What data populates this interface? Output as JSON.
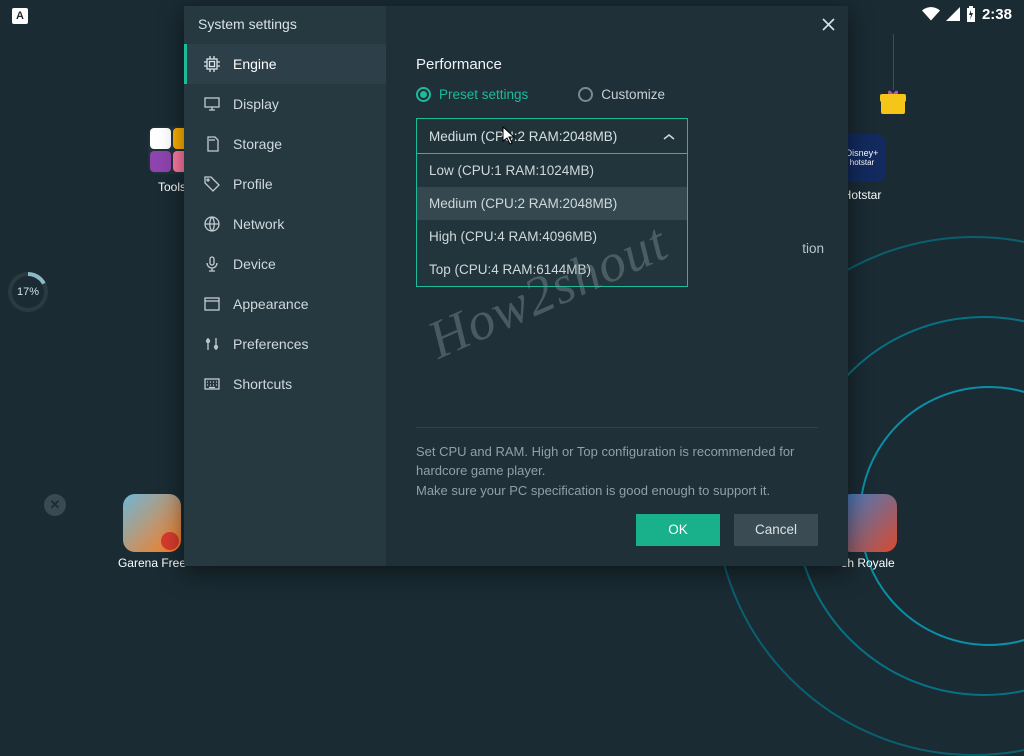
{
  "status_bar": {
    "time": "2:38"
  },
  "progress_badge": "17%",
  "desktop": {
    "tools_label": "Tools",
    "hotstar_label": "Hotstar",
    "garena_label": "Garena Free",
    "royale_label": "sh Royale"
  },
  "watermark": "How2shout",
  "modal": {
    "title": "System settings",
    "nav": [
      {
        "label": "Engine",
        "icon": "cpu-icon"
      },
      {
        "label": "Display",
        "icon": "monitor-icon"
      },
      {
        "label": "Storage",
        "icon": "sdcard-icon"
      },
      {
        "label": "Profile",
        "icon": "tag-icon"
      },
      {
        "label": "Network",
        "icon": "globe-icon"
      },
      {
        "label": "Device",
        "icon": "mic-icon"
      },
      {
        "label": "Appearance",
        "icon": "window-icon"
      },
      {
        "label": "Preferences",
        "icon": "sliders-icon"
      },
      {
        "label": "Shortcuts",
        "icon": "keyboard-icon"
      }
    ],
    "pane": {
      "section_title": "Performance",
      "radio_preset": "Preset settings",
      "radio_custom": "Customize",
      "select_value": "Medium (CPU:2 RAM:2048MB)",
      "options": [
        "Low (CPU:1 RAM:1024MB)",
        "Medium (CPU:2 RAM:2048MB)",
        "High (CPU:4 RAM:4096MB)",
        "Top (CPU:4 RAM:6144MB)"
      ],
      "trailing_text": "tion",
      "help_line1": "Set CPU and RAM. High or Top configuration is recommended for hardcore game player.",
      "help_line2": "Make sure your PC specification is good enough to support it.",
      "ok_label": "OK",
      "cancel_label": "Cancel"
    }
  }
}
